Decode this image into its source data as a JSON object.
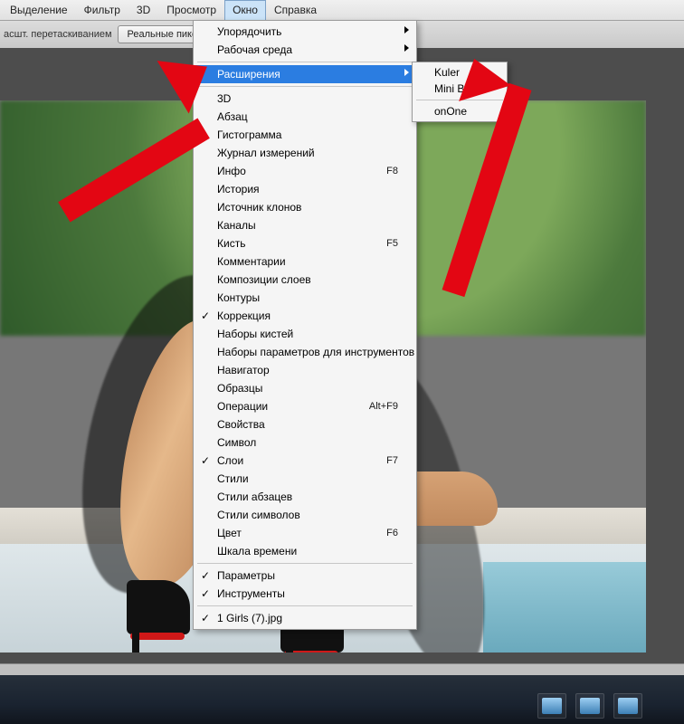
{
  "menubar": {
    "items": [
      "Выделение",
      "Фильтр",
      "3D",
      "Просмотр",
      "Окно",
      "Справка"
    ],
    "active_index": 4
  },
  "optionsbar": {
    "drag_label": "асшт. перетаскиванием",
    "real_pixels_btn": "Реальные пикселы"
  },
  "window_menu": {
    "sections": [
      {
        "type": "item",
        "label": "Упорядочить",
        "submenu": true
      },
      {
        "type": "item",
        "label": "Рабочая среда",
        "submenu": true
      },
      {
        "type": "sep"
      },
      {
        "type": "item",
        "label": "Расширения",
        "submenu": true,
        "highlighted": true
      },
      {
        "type": "sep"
      },
      {
        "type": "item",
        "label": "3D"
      },
      {
        "type": "item",
        "label": "Абзац"
      },
      {
        "type": "item",
        "label": "Гистограмма"
      },
      {
        "type": "item",
        "label": "Журнал измерений"
      },
      {
        "type": "item",
        "label": "Инфо",
        "shortcut": "F8"
      },
      {
        "type": "item",
        "label": "История"
      },
      {
        "type": "item",
        "label": "Источник клонов"
      },
      {
        "type": "item",
        "label": "Каналы"
      },
      {
        "type": "item",
        "label": "Кисть",
        "shortcut": "F5"
      },
      {
        "type": "item",
        "label": "Комментарии"
      },
      {
        "type": "item",
        "label": "Композиции слоев"
      },
      {
        "type": "item",
        "label": "Контуры"
      },
      {
        "type": "item",
        "label": "Коррекция",
        "checked": true
      },
      {
        "type": "item",
        "label": "Наборы кистей"
      },
      {
        "type": "item",
        "label": "Наборы параметров для инструментов"
      },
      {
        "type": "item",
        "label": "Навигатор"
      },
      {
        "type": "item",
        "label": "Образцы"
      },
      {
        "type": "item",
        "label": "Операции",
        "shortcut": "Alt+F9"
      },
      {
        "type": "item",
        "label": "Свойства"
      },
      {
        "type": "item",
        "label": "Символ"
      },
      {
        "type": "item",
        "label": "Слои",
        "shortcut": "F7",
        "checked": true
      },
      {
        "type": "item",
        "label": "Стили"
      },
      {
        "type": "item",
        "label": "Стили абзацев"
      },
      {
        "type": "item",
        "label": "Стили символов"
      },
      {
        "type": "item",
        "label": "Цвет",
        "shortcut": "F6"
      },
      {
        "type": "item",
        "label": "Шкала времени"
      },
      {
        "type": "sep"
      },
      {
        "type": "item",
        "label": "Параметры",
        "checked": true
      },
      {
        "type": "item",
        "label": "Инструменты",
        "checked": true
      },
      {
        "type": "sep"
      },
      {
        "type": "item",
        "label": "1 Girls (7).jpg",
        "checked": true
      }
    ]
  },
  "extensions_submenu": {
    "items": [
      {
        "label": "Kuler"
      },
      {
        "label": "Mini Bridge"
      },
      {
        "type": "sep"
      },
      {
        "label": "onOne"
      }
    ]
  }
}
